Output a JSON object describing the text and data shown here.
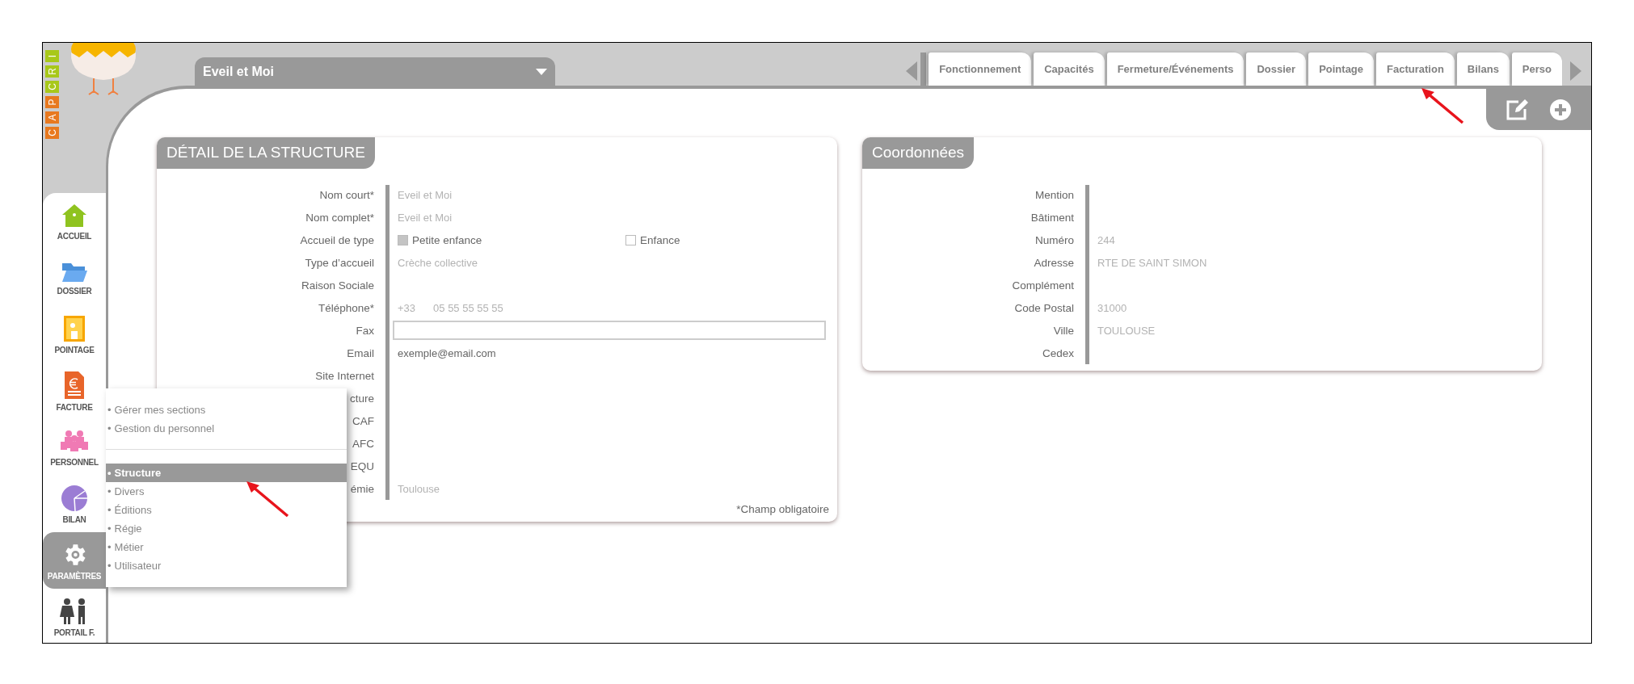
{
  "logo": {
    "letters": [
      {
        "char": "C",
        "color": "#e8791f"
      },
      {
        "char": "A",
        "color": "#e8791f"
      },
      {
        "char": "P",
        "color": "#e8791f"
      },
      {
        "char": "C",
        "color": "#a8c81a"
      },
      {
        "char": "R",
        "color": "#a8c81a"
      },
      {
        "char": "I",
        "color": "#a8c81a"
      }
    ]
  },
  "structure_selector": {
    "value": "Eveil et Moi"
  },
  "tabs": [
    {
      "label": "Fonctionnement"
    },
    {
      "label": "Capacités"
    },
    {
      "label": "Fermeture/Événements"
    },
    {
      "label": "Dossier"
    },
    {
      "label": "Pointage"
    },
    {
      "label": "Facturation"
    },
    {
      "label": "Bilans"
    },
    {
      "label": "Perso"
    }
  ],
  "sidebar": {
    "items": [
      {
        "label": "ACCUEIL",
        "selected": false
      },
      {
        "label": "DOSSIER",
        "selected": false
      },
      {
        "label": "POINTAGE",
        "selected": false
      },
      {
        "label": "FACTURE",
        "selected": false
      },
      {
        "label": "PERSONNEL",
        "selected": false
      },
      {
        "label": "BILAN",
        "selected": false
      },
      {
        "label": "PARAMÈTRES",
        "selected": true
      },
      {
        "label": "PORTAIL F.",
        "selected": false
      }
    ]
  },
  "menu": {
    "bullet": "•",
    "groups": [
      [
        {
          "label": "Gérer mes sections",
          "selected": false
        },
        {
          "label": "Gestion du personnel",
          "selected": false
        }
      ],
      [
        {
          "label": "Structure",
          "selected": true
        },
        {
          "label": "Divers",
          "selected": false
        },
        {
          "label": "Éditions",
          "selected": false
        },
        {
          "label": "Régie",
          "selected": false
        },
        {
          "label": "Métier",
          "selected": false
        },
        {
          "label": "Utilisateur",
          "selected": false
        }
      ]
    ]
  },
  "structure_card": {
    "title": "DÉTAIL DE LA STRUCTURE",
    "rows": [
      {
        "label": "Nom court*",
        "kind": "readonly",
        "value": "Eveil et Moi"
      },
      {
        "label": "Nom complet*",
        "kind": "readonly",
        "value": "Eveil et Moi"
      },
      {
        "label": "Accueil de type",
        "kind": "checks",
        "options": [
          {
            "label": "Petite enfance",
            "checked": true
          },
          {
            "label": "Enfance",
            "checked": false
          }
        ]
      },
      {
        "label": "Type d’accueil",
        "kind": "readonly",
        "value": "Crèche collective"
      },
      {
        "label": "Raison Sociale",
        "kind": "empty"
      },
      {
        "label": "Téléphone*",
        "kind": "phone",
        "prefix": "+33",
        "value": "05 55 55 55 55"
      },
      {
        "label": "Fax",
        "kind": "input"
      },
      {
        "label": "Email",
        "kind": "value",
        "value": "exemple@email.com"
      },
      {
        "label": "Site Internet",
        "kind": "empty"
      },
      {
        "label": "cture",
        "kind": "empty"
      },
      {
        "label": "CAF",
        "kind": "empty"
      },
      {
        "label": "AFC",
        "kind": "empty"
      },
      {
        "label": "EQU",
        "kind": "empty"
      },
      {
        "label": "émie",
        "kind": "readonly",
        "value": "Toulouse"
      }
    ],
    "footnote": "*Champ obligatoire"
  },
  "contact_card": {
    "title": "Coordonnées",
    "rows": [
      {
        "label": "Mention",
        "kind": "empty"
      },
      {
        "label": "Bâtiment",
        "kind": "empty"
      },
      {
        "label": "Numéro",
        "kind": "readonly",
        "value": "244"
      },
      {
        "label": "Adresse",
        "kind": "readonly",
        "value": "RTE DE SAINT SIMON"
      },
      {
        "label": "Complément",
        "kind": "empty"
      },
      {
        "label": "Code Postal",
        "kind": "readonly",
        "value": "31000"
      },
      {
        "label": "Ville",
        "kind": "readonly",
        "value": "TOULOUSE"
      },
      {
        "label": "Cedex",
        "kind": "empty"
      }
    ]
  }
}
